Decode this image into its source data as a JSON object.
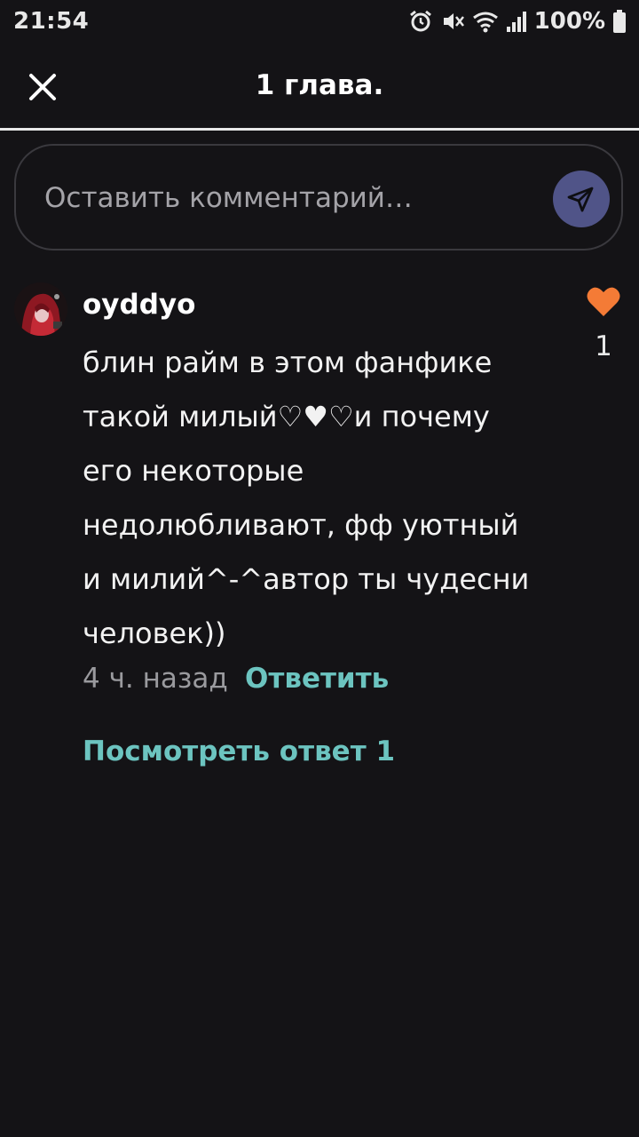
{
  "status_bar": {
    "time": "21:54",
    "battery": "100%",
    "icons": [
      "alarm-icon",
      "mute-icon",
      "wifi-icon",
      "signal-icon",
      "battery-icon"
    ]
  },
  "header": {
    "title": "1 глава.",
    "close_icon": "close-icon"
  },
  "comment_input": {
    "placeholder": "Оставить комментарий…",
    "send_icon": "send-icon",
    "send_button_color": "#505488"
  },
  "comments": [
    {
      "username": "oyddyo",
      "text": "блин райм в этом фанфике\nтакой милый♡♥♡и почему\nего некоторые\nнедолюбливают, фф уютный\nи милий^-^автор ты чудесни\nчеловек))",
      "time": "4 ч. назад",
      "reply_label": "Ответить",
      "view_replies_label": "Посмотреть ответ 1",
      "likes": "1",
      "like_color": "#f47b36"
    }
  ],
  "colors": {
    "background": "#141316",
    "accent": "#6cc4c0",
    "like": "#f47b36"
  }
}
